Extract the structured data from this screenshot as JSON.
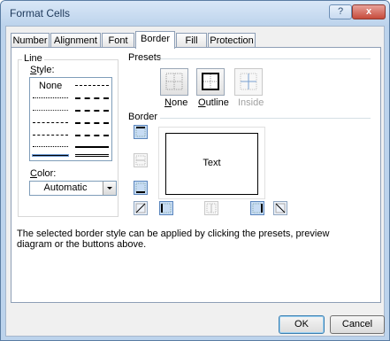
{
  "window": {
    "title": "Format Cells",
    "help_glyph": "?",
    "close_glyph": "x"
  },
  "tabs": [
    "Number",
    "Alignment",
    "Font",
    "Border",
    "Fill",
    "Protection"
  ],
  "active_tab": "Border",
  "line": {
    "group_label": "Line",
    "style_label": "Style:",
    "style_none": "None",
    "color_label": "Color:",
    "color_value": "Automatic"
  },
  "presets": {
    "group_label": "Presets",
    "items": [
      {
        "label": "None",
        "enabled": true
      },
      {
        "label": "Outline",
        "enabled": true
      },
      {
        "label": "Inside",
        "enabled": false
      }
    ]
  },
  "border": {
    "group_label": "Border",
    "preview_text": "Text"
  },
  "description": "The selected border style can be applied by clicking the presets, preview diagram or the buttons above.",
  "buttons": {
    "ok": "OK",
    "cancel": "Cancel"
  },
  "colors": {
    "title_text": "#1e395b",
    "selected_button": "#c7dcf4",
    "disabled_text": "#a0a0a0"
  }
}
